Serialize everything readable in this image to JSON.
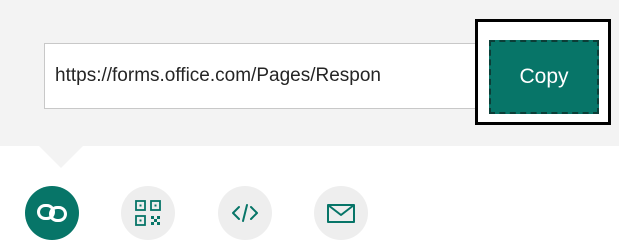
{
  "link": {
    "url": "https://forms.office.com/Pages/Respon"
  },
  "copy_button": {
    "label": "Copy"
  },
  "share_options": [
    {
      "icon": "link-icon",
      "active": true
    },
    {
      "icon": "qr-code-icon",
      "active": false
    },
    {
      "icon": "embed-code-icon",
      "active": false
    },
    {
      "icon": "mail-icon",
      "active": false
    }
  ],
  "colors": {
    "accent": "#077568",
    "panel_background": "#f3f3f3",
    "inactive_icon_background": "#eeeeee",
    "inactive_icon_stroke": "#077568",
    "focus_ring": "#000000"
  }
}
